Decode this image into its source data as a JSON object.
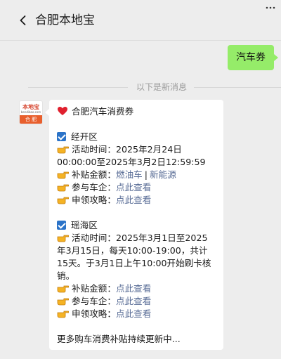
{
  "header": {
    "title": "合肥本地宝",
    "back_icon": "chevron-left-icon",
    "more_icon": "more-dots-icon"
  },
  "my_message": {
    "text": "汽车券"
  },
  "divider": {
    "text": "以下是新消息"
  },
  "avatar": {
    "brand": "本地宝",
    "brand_sub": "bendibao.com",
    "city": "合 肥"
  },
  "message": {
    "title": "合肥汽车消费券",
    "sections": [
      {
        "area": "经开区",
        "time_label": "活动时间：",
        "time_value_1": "2025年2月24日",
        "time_value_2": "00:00:00至2025年3月2日12:59:59",
        "amount_label": "补贴金额：",
        "amount_link_1": "燃油车",
        "amount_sep": "|",
        "amount_link_2": "新能源",
        "car_label": "参与车企：",
        "car_link": "点此查看",
        "guide_label": "申领攻略：",
        "guide_link": "点此查看"
      },
      {
        "area": "瑶海区",
        "time_label": "活动时间：",
        "time_value_1": "2025年3月1日至2025",
        "time_value_2": "年3月15日，每天10:00-19:00，共计",
        "time_value_3": "15天。于3月1日上午10:00开始刷卡核",
        "time_value_4": "销。",
        "amount_label": "补贴金额：",
        "amount_link": "点此查看",
        "car_label": "参与车企：",
        "car_link": "点此查看",
        "guide_label": "申领攻略：",
        "guide_link": "点此查看"
      }
    ],
    "footer": "更多购车消费补贴持续更新中..."
  },
  "colors": {
    "bubble_me": "#95ec69",
    "link": "#576b95",
    "checkbox": "#2b73c8",
    "background": "#ededed"
  }
}
